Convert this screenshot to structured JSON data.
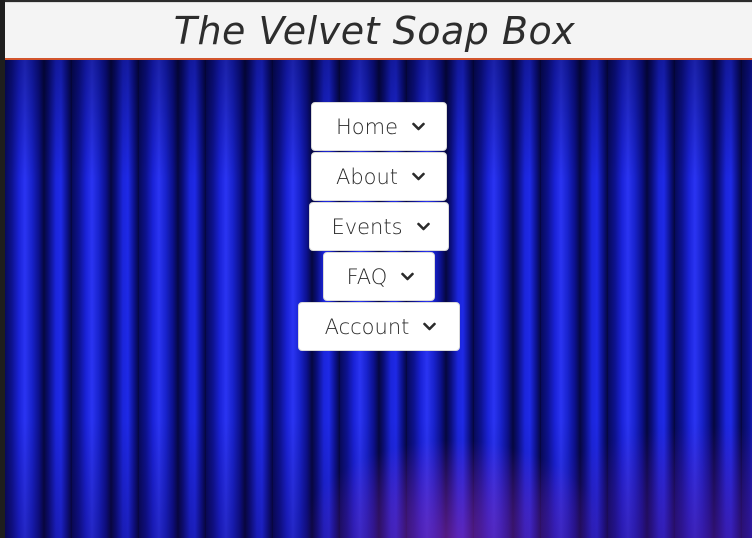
{
  "site": {
    "title": "The Velvet Soap Box"
  },
  "nav": {
    "items": [
      {
        "label": "Home",
        "icon": "chevron-down"
      },
      {
        "label": "About",
        "icon": "chevron-down"
      },
      {
        "label": "Events",
        "icon": "chevron-down"
      },
      {
        "label": "FAQ",
        "icon": "chevron-down"
      },
      {
        "label": "Account",
        "icon": "chevron-down"
      }
    ]
  },
  "colors": {
    "header_bg": "#f4f4f4",
    "header_border": "#d2542c",
    "curtain": "#1a22d8",
    "button_bg": "#ffffff"
  }
}
